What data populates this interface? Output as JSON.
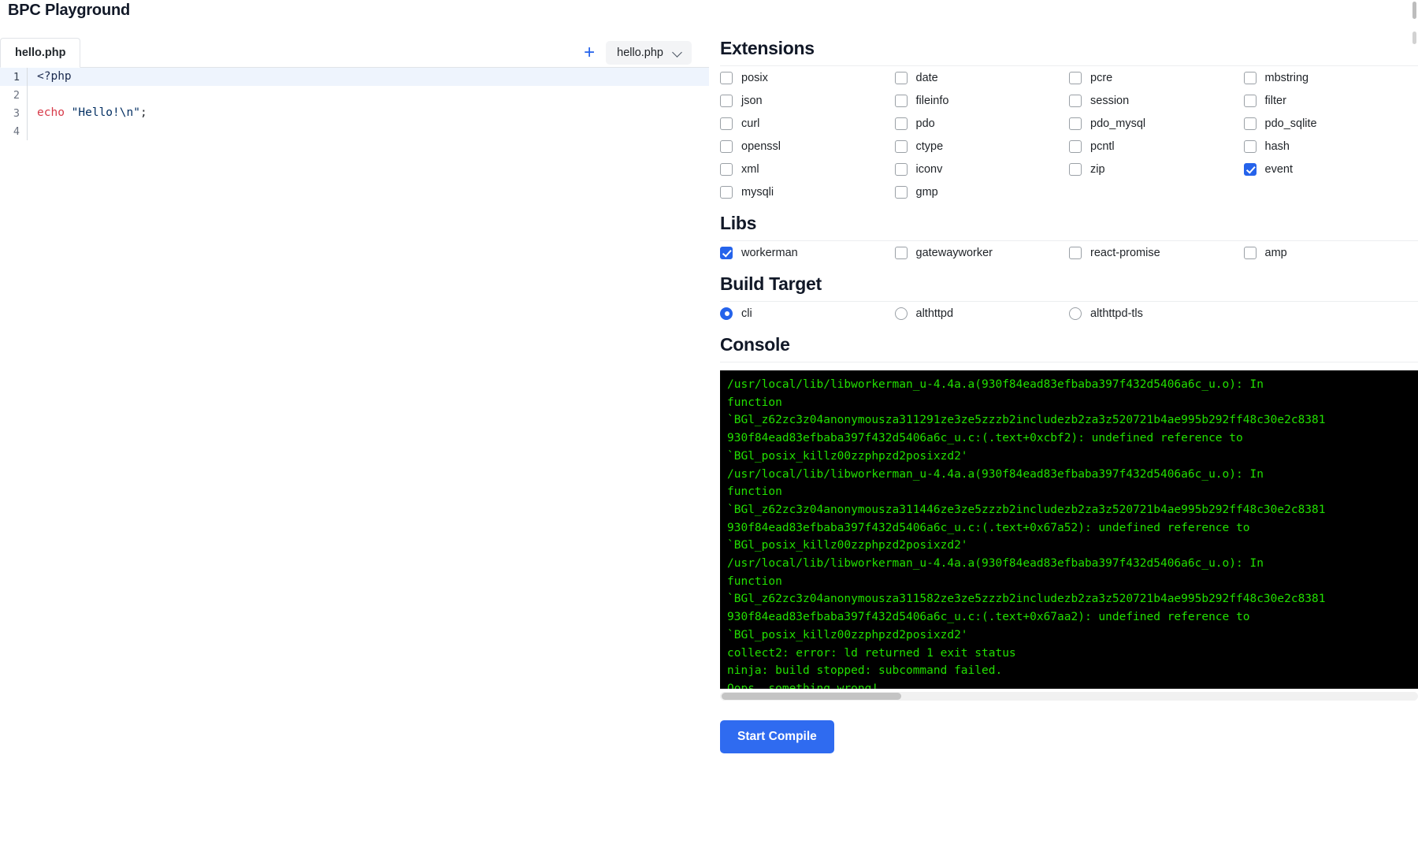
{
  "app": {
    "title": "BPC Playground"
  },
  "editor": {
    "tabs": [
      {
        "label": "hello.php",
        "active": true
      }
    ],
    "add_tab_icon": "plus-icon",
    "file_select": {
      "value": "hello.php",
      "icon": "chevron-down-icon"
    },
    "lines": [
      {
        "number": "1",
        "active": true,
        "tokens": [
          {
            "text": "<?php",
            "type": "tag"
          }
        ]
      },
      {
        "number": "2",
        "active": false,
        "tokens": []
      },
      {
        "number": "3",
        "active": false,
        "tokens": [
          {
            "text": "echo",
            "type": "kw"
          },
          {
            "text": " ",
            "type": "punc"
          },
          {
            "text": "\"Hello!\\n\"",
            "type": "str"
          },
          {
            "text": ";",
            "type": "punc"
          }
        ]
      },
      {
        "number": "4",
        "active": false,
        "tokens": []
      }
    ]
  },
  "extensions": {
    "title": "Extensions",
    "items": [
      {
        "label": "posix",
        "checked": false
      },
      {
        "label": "date",
        "checked": false
      },
      {
        "label": "pcre",
        "checked": false
      },
      {
        "label": "mbstring",
        "checked": false
      },
      {
        "label": "json",
        "checked": false
      },
      {
        "label": "fileinfo",
        "checked": false
      },
      {
        "label": "session",
        "checked": false
      },
      {
        "label": "filter",
        "checked": false
      },
      {
        "label": "curl",
        "checked": false
      },
      {
        "label": "pdo",
        "checked": false
      },
      {
        "label": "pdo_mysql",
        "checked": false
      },
      {
        "label": "pdo_sqlite",
        "checked": false
      },
      {
        "label": "openssl",
        "checked": false
      },
      {
        "label": "ctype",
        "checked": false
      },
      {
        "label": "pcntl",
        "checked": false
      },
      {
        "label": "hash",
        "checked": false
      },
      {
        "label": "xml",
        "checked": false
      },
      {
        "label": "iconv",
        "checked": false
      },
      {
        "label": "zip",
        "checked": false
      },
      {
        "label": "event",
        "checked": true
      },
      {
        "label": "mysqli",
        "checked": false
      },
      {
        "label": "gmp",
        "checked": false
      }
    ]
  },
  "libs": {
    "title": "Libs",
    "items": [
      {
        "label": "workerman",
        "checked": true
      },
      {
        "label": "gatewayworker",
        "checked": false
      },
      {
        "label": "react-promise",
        "checked": false
      },
      {
        "label": "amp",
        "checked": false
      }
    ]
  },
  "build_target": {
    "title": "Build Target",
    "options": [
      {
        "label": "cli",
        "selected": true
      },
      {
        "label": "althttpd",
        "selected": false
      },
      {
        "label": "althttpd-tls",
        "selected": false
      }
    ]
  },
  "console": {
    "title": "Console",
    "lines": [
      "/usr/local/lib/libworkerman_u-4.4a.a(930f84ead83efbaba397f432d5406a6c_u.o): In",
      "function",
      "`BGl_z62zc3z04anonymousza311291ze3ze5zzzb2includezb2za3z520721b4ae995b292ff48c30e2c8381",
      "930f84ead83efbaba397f432d5406a6c_u.c:(.text+0xcbf2): undefined reference to",
      "`BGl_posix_killz00zzphpzd2posixzd2'",
      "/usr/local/lib/libworkerman_u-4.4a.a(930f84ead83efbaba397f432d5406a6c_u.o): In",
      "function",
      "`BGl_z62zc3z04anonymousza311446ze3ze5zzzb2includezb2za3z520721b4ae995b292ff48c30e2c8381",
      "930f84ead83efbaba397f432d5406a6c_u.c:(.text+0x67a52): undefined reference to",
      "`BGl_posix_killz00zzphpzd2posixzd2'",
      "/usr/local/lib/libworkerman_u-4.4a.a(930f84ead83efbaba397f432d5406a6c_u.o): In",
      "function",
      "`BGl_z62zc3z04anonymousza311582ze3ze5zzzb2includezb2za3z520721b4ae995b292ff48c30e2c8381",
      "930f84ead83efbaba397f432d5406a6c_u.c:(.text+0x67aa2): undefined reference to",
      "`BGl_posix_killz00zzphpzd2posixzd2'",
      "collect2: error: ld returned 1 exit status",
      "ninja: build stopped: subcommand failed.",
      "Oops, something wrong!"
    ]
  },
  "actions": {
    "compile_label": "Start Compile"
  },
  "colors": {
    "accent": "#2563eb",
    "button": "#2f6bf0",
    "console_bg": "#000000",
    "console_text": "#22e000",
    "keyword": "#d73a49",
    "string": "#032f62"
  }
}
